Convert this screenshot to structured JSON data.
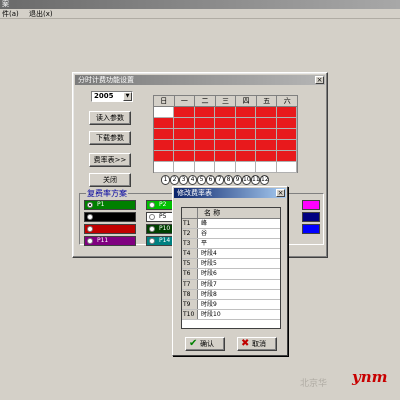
{
  "app": {
    "title": "案",
    "menu": [
      "件(a)",
      "退出(x)"
    ]
  },
  "settings_window": {
    "title": "分时计费功能设置",
    "close": "×",
    "year": "2005",
    "buttons": {
      "read_params": "读入参数",
      "download_params": "下载参数",
      "rate_table": "费率表>>",
      "close": "关闭"
    },
    "calendar": {
      "weekdays": [
        "日",
        "一",
        "二",
        "三",
        "四",
        "五",
        "六"
      ],
      "cells": [
        {
          "t": "",
          "red": false
        },
        {
          "t": "",
          "red": true
        },
        {
          "t": "",
          "red": true
        },
        {
          "t": "",
          "red": true
        },
        {
          "t": "",
          "red": true
        },
        {
          "t": "",
          "red": true
        },
        {
          "t": "",
          "red": true
        },
        {
          "t": "",
          "red": true
        },
        {
          "t": "",
          "red": true
        },
        {
          "t": "",
          "red": true
        },
        {
          "t": "",
          "red": true
        },
        {
          "t": "",
          "red": true
        },
        {
          "t": "",
          "red": true
        },
        {
          "t": "",
          "red": true
        },
        {
          "t": "",
          "red": true
        },
        {
          "t": "",
          "red": true
        },
        {
          "t": "",
          "red": true
        },
        {
          "t": "",
          "red": true
        },
        {
          "t": "",
          "red": true
        },
        {
          "t": "",
          "red": true
        },
        {
          "t": "",
          "red": true
        },
        {
          "t": "",
          "red": true
        },
        {
          "t": "",
          "red": true
        },
        {
          "t": "",
          "red": true
        },
        {
          "t": "",
          "red": true
        },
        {
          "t": "",
          "red": true
        },
        {
          "t": "",
          "red": true
        },
        {
          "t": "",
          "red": true
        },
        {
          "t": "",
          "red": true
        },
        {
          "t": "",
          "red": true
        },
        {
          "t": "",
          "red": true
        },
        {
          "t": "",
          "red": true
        },
        {
          "t": "",
          "red": true
        },
        {
          "t": "",
          "red": true
        },
        {
          "t": "",
          "red": true
        },
        {
          "t": "",
          "red": false
        },
        {
          "t": "",
          "red": false
        },
        {
          "t": "",
          "red": false
        },
        {
          "t": "",
          "red": false
        },
        {
          "t": "",
          "red": false
        },
        {
          "t": "",
          "red": false
        },
        {
          "t": "",
          "red": false
        }
      ]
    },
    "months": [
      "1",
      "2",
      "3",
      "4",
      "5",
      "6",
      "7",
      "8",
      "9",
      "10",
      "11",
      "12"
    ],
    "scheme_group_label": "复费率方案",
    "schemes": [
      {
        "label": "P1",
        "color": "#008000",
        "on": true
      },
      {
        "label": "P2",
        "color": "#00c000",
        "on": false
      },
      {
        "label": "",
        "color": "#000000",
        "on": false
      },
      {
        "label": "P5",
        "color": "#ffffff",
        "on": false
      },
      {
        "label": "",
        "color": "#c00000",
        "on": false
      },
      {
        "label": "P10",
        "color": "#004000",
        "on": false
      },
      {
        "label": "P11",
        "color": "#800080",
        "on": false
      },
      {
        "label": "P14",
        "color": "#008080",
        "on": false
      }
    ],
    "right_swatches": [
      "#ff00ff",
      "#000080",
      "#0000ff"
    ]
  },
  "rate_dialog": {
    "title": "修改费率表",
    "close": "×",
    "header": "名 称",
    "rows": [
      {
        "id": "T1",
        "name": "峰"
      },
      {
        "id": "T2",
        "name": "谷"
      },
      {
        "id": "T3",
        "name": "平"
      },
      {
        "id": "T4",
        "name": "时段4"
      },
      {
        "id": "T5",
        "name": "时段5"
      },
      {
        "id": "T6",
        "name": "时段6"
      },
      {
        "id": "T7",
        "name": "时段7"
      },
      {
        "id": "T8",
        "name": "时段8"
      },
      {
        "id": "T9",
        "name": "时段9"
      },
      {
        "id": "T10",
        "name": "时段10"
      }
    ],
    "ok": "确认",
    "cancel": "取消"
  },
  "watermark": {
    "text": "北京华",
    "brand": "ynm"
  }
}
